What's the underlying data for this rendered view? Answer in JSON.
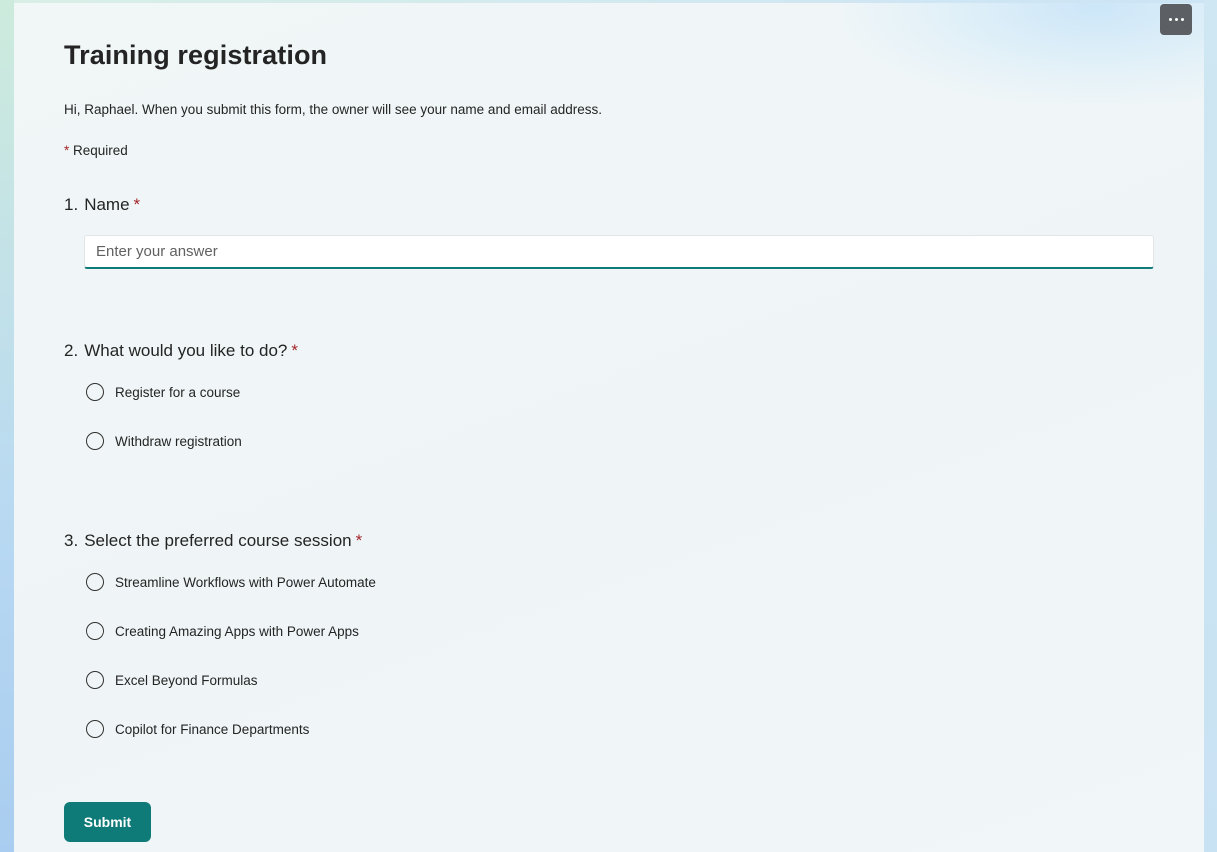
{
  "form": {
    "title": "Training registration",
    "subtitle": "Hi, Raphael. When you submit this form, the owner will see your name and email address.",
    "required_mark": "*",
    "required_label": "Required",
    "more_icon": "more-horizontal-icon"
  },
  "questions": [
    {
      "number": "1.",
      "text": "Name",
      "required_mark": "*",
      "type": "text",
      "placeholder": "Enter your answer",
      "value": ""
    },
    {
      "number": "2.",
      "text": "What would you like to do?",
      "required_mark": "*",
      "type": "radio",
      "options": [
        "Register for a course",
        "Withdraw registration"
      ]
    },
    {
      "number": "3.",
      "text": "Select the preferred course session",
      "required_mark": "*",
      "type": "radio",
      "options": [
        "Streamline Workflows with Power Automate",
        "Creating Amazing Apps with Power Apps",
        "Excel Beyond Formulas",
        "Copilot for Finance Departments"
      ]
    }
  ],
  "actions": {
    "submit_label": "Submit"
  },
  "colors": {
    "accent": "#0f7b78",
    "required": "#a4262c",
    "more_button_bg": "#5c5f63"
  }
}
